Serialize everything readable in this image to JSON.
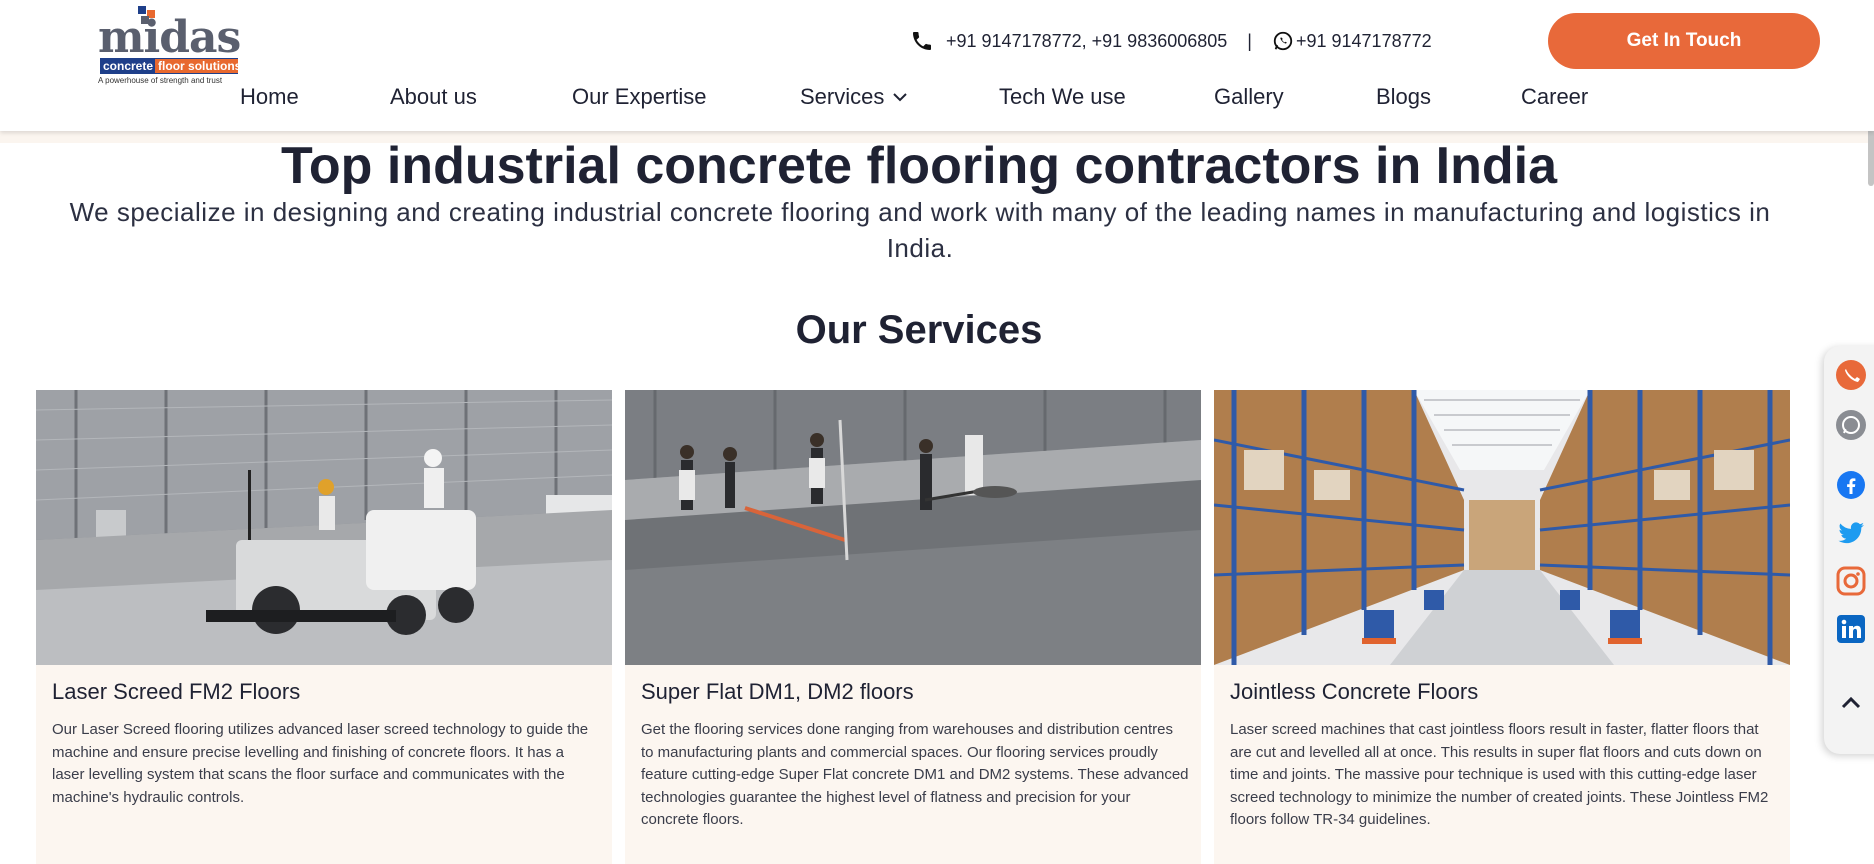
{
  "brand": {
    "name": "midas",
    "strip_primary": "concrete",
    "strip_accent": "floor solutions",
    "tagline": "A powerhouse of strength and trust",
    "colors": {
      "orange": "#e8693a",
      "navy": "#1e3f8a",
      "text": "#1f2233",
      "card_bg": "#fcf6f0"
    }
  },
  "contact": {
    "phone_icon": "phone-icon",
    "phones": "+91 9147178772,  +91 9836006805",
    "separator": "|",
    "whatsapp_icon": "whatsapp-icon",
    "whatsapp": "+91 9147178772"
  },
  "cta": {
    "label": "Get In Touch"
  },
  "nav": {
    "items": [
      {
        "label": "Home"
      },
      {
        "label": "About us"
      },
      {
        "label": "Our Expertise"
      },
      {
        "label": "Services",
        "icon": "chevron-down-icon"
      },
      {
        "label": "Tech We use"
      },
      {
        "label": "Gallery"
      },
      {
        "label": "Blogs"
      },
      {
        "label": "Career"
      }
    ]
  },
  "hero": {
    "title": "Top industrial concrete flooring contractors in India",
    "subtitle": "We specialize in designing and creating industrial concrete flooring and work with many of the leading names in manufacturing and logistics in India."
  },
  "services": {
    "heading": "Our Services",
    "cards": [
      {
        "title": "Laser Screed FM2 Floors",
        "image": "laser-screed-machine-photo",
        "description": "Our Laser Screed flooring utilizes advanced laser screed technology to guide the machine and ensure precise levelling and finishing of concrete floors. It has a laser levelling system that scans the floor surface and communicates with the machine's hydraulic controls."
      },
      {
        "title": "Super Flat DM1, DM2 floors",
        "image": "workers-leveling-floor-photo",
        "description": "Get the flooring services done ranging from warehouses and distribution centres to manufacturing plants and commercial spaces. Our flooring services proudly feature cutting-edge Super Flat concrete DM1 and DM2 systems. These advanced technologies guarantee the highest level of flatness and precision for your concrete floors."
      },
      {
        "title": "Jointless Concrete Floors",
        "image": "warehouse-racking-photo",
        "description": "Laser screed machines that cast jointless floors result in faster, flatter floors that are cut and levelled all at once. This results in super flat floors and cuts down on time and joints. The massive pour technique is used with this cutting-edge laser screed technology to minimize the number of created joints. These Jointless FM2 floors follow TR-34 guidelines."
      }
    ]
  },
  "social": {
    "icons": [
      "phone-icon",
      "whatsapp-icon",
      "facebook-icon",
      "twitter-icon",
      "instagram-icon",
      "linkedin-icon",
      "chevron-up-icon"
    ]
  }
}
